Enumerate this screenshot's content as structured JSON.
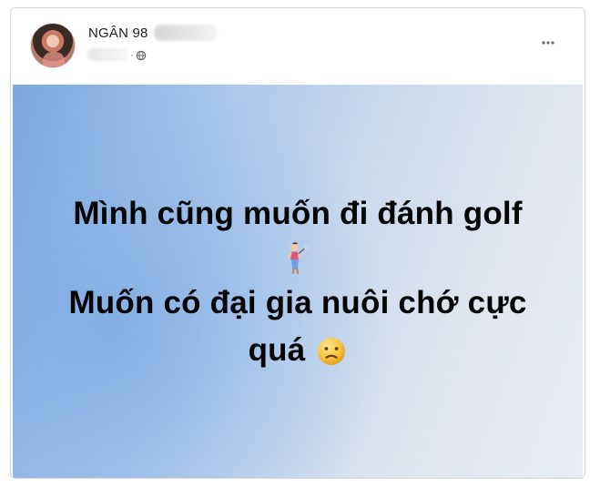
{
  "post": {
    "user_name": "NGÂN 98",
    "meta_separator": "·",
    "text_lines": [
      "Mình cũng muốn đi đánh golf",
      "Muốn có đại gia nuôi chớ cực",
      "quá"
    ]
  },
  "icons": {
    "privacy": "globe-icon",
    "menu": "more-icon",
    "golf": "golfer-icon",
    "emotion": "sad-face-icon"
  },
  "colors": {
    "text": "#050505",
    "meta": "#65676b",
    "card_border": "#d7d9de",
    "background_blue": "#7aa7e0",
    "background_light": "#e8edf4"
  }
}
